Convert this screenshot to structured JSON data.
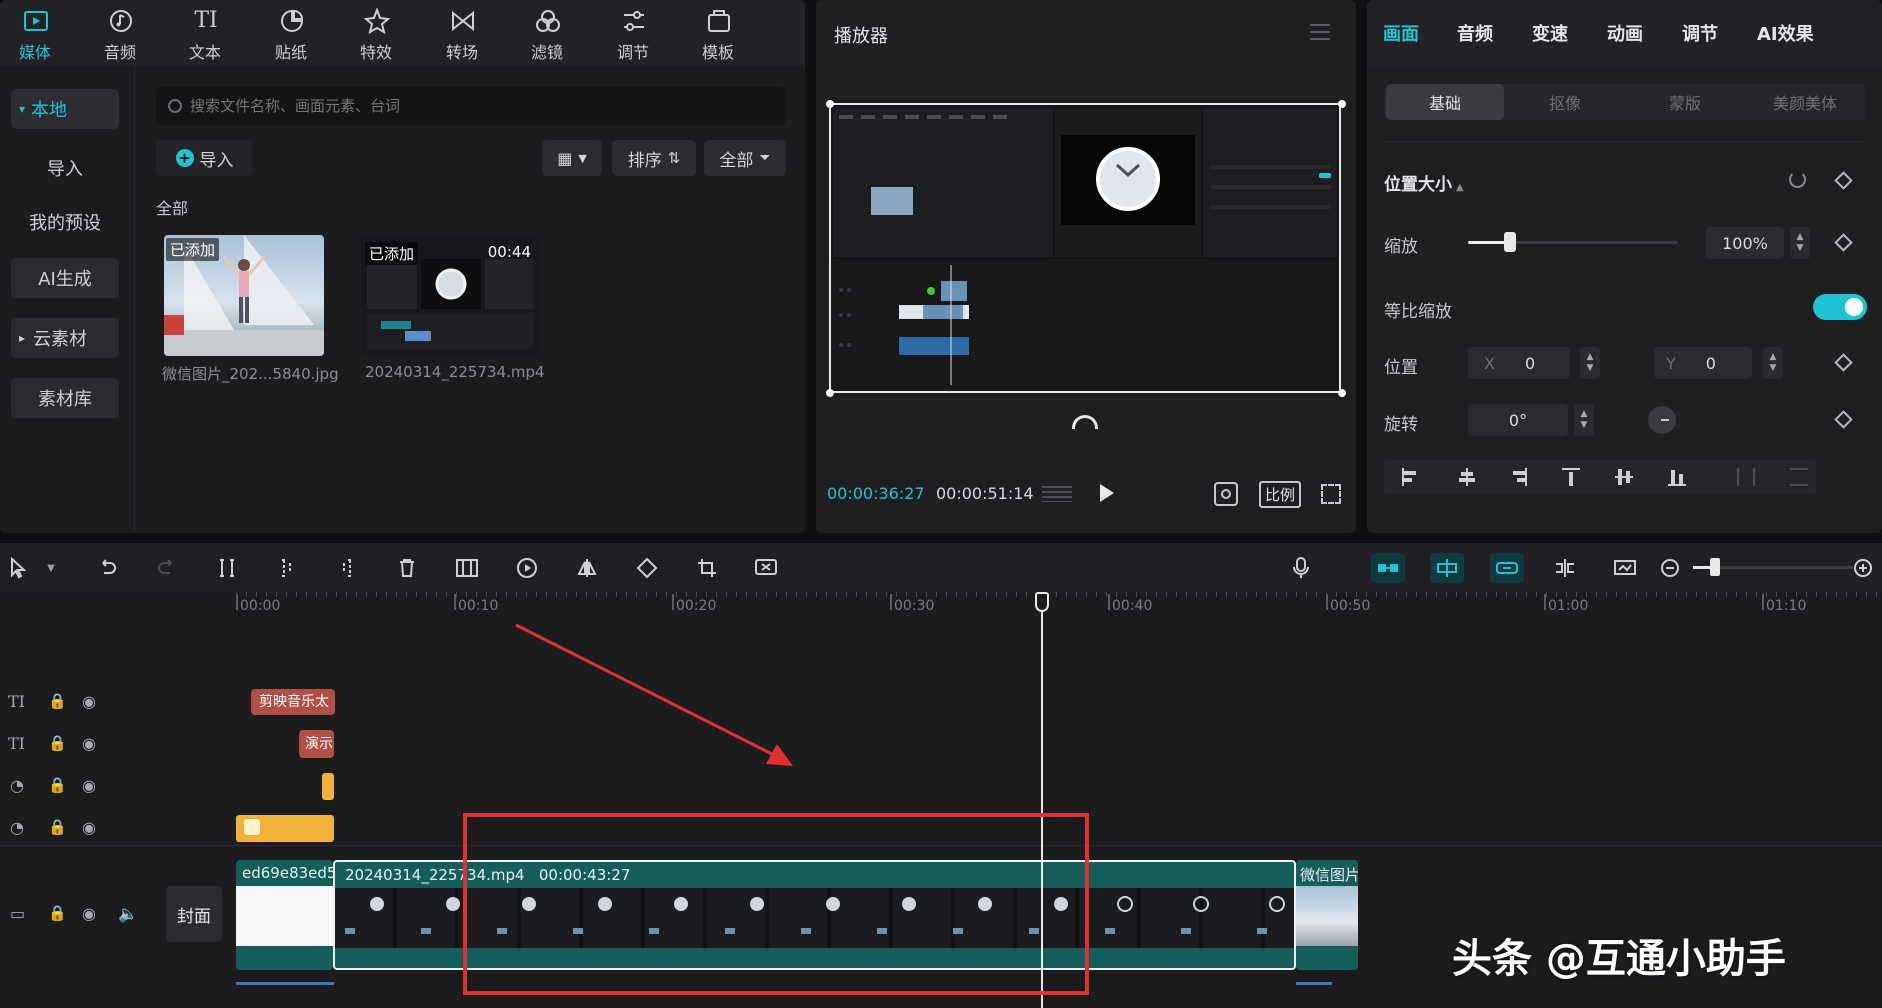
{
  "media_panel": {
    "tabs": [
      {
        "label": "媒体",
        "icon": "media-icon",
        "active": true
      },
      {
        "label": "音频",
        "icon": "audio-icon"
      },
      {
        "label": "文本",
        "icon": "text-icon"
      },
      {
        "label": "贴纸",
        "icon": "sticker-icon"
      },
      {
        "label": "特效",
        "icon": "effects-icon"
      },
      {
        "label": "转场",
        "icon": "transition-icon"
      },
      {
        "label": "滤镜",
        "icon": "filter-icon"
      },
      {
        "label": "调节",
        "icon": "adjust-icon"
      },
      {
        "label": "模板",
        "icon": "template-icon"
      }
    ],
    "sidebar": [
      {
        "label": "本地",
        "active": true,
        "arrow": "▾"
      },
      {
        "label": "导入"
      },
      {
        "label": "我的预设"
      },
      {
        "label": "AI生成"
      },
      {
        "label": "云素材",
        "arrow": "▸"
      },
      {
        "label": "素材库"
      }
    ],
    "search_placeholder": "搜索文件名称、画面元素、台词",
    "import_label": "导入",
    "sort_label": "排序",
    "filter_label": "全部",
    "section_label": "全部",
    "files": [
      {
        "name": "微信图片_202...5840.jpg",
        "badge": "已添加"
      },
      {
        "name": "20240314_225734.mp4",
        "badge": "已添加",
        "duration": "00:44"
      }
    ]
  },
  "player": {
    "title": "播放器",
    "current_time": "00:00:36:27",
    "total_time": "00:00:51:14",
    "ratio_label": "比例"
  },
  "properties": {
    "tabs": [
      "画面",
      "音频",
      "变速",
      "动画",
      "调节",
      "AI效果"
    ],
    "active_tab": "画面",
    "subtabs": [
      "基础",
      "抠像",
      "蒙版",
      "美颜美体"
    ],
    "active_subtab": "基础",
    "section_title": "位置大小",
    "scale_label": "缩放",
    "scale_value": "100%",
    "scale_fraction": 0.2,
    "uniform_label": "等比缩放",
    "uniform_on": true,
    "position_label": "位置",
    "x_label": "X",
    "x_value": "0",
    "y_label": "Y",
    "y_value": "0",
    "rotation_label": "旋转",
    "rotation_value": "0°"
  },
  "timeline": {
    "ruler": [
      "00:00",
      "00:10",
      "00:20",
      "00:30",
      "00:40",
      "00:50",
      "01:00",
      "01:10"
    ],
    "clips": {
      "text1": "剪映音乐太",
      "text2": "演示",
      "main_a": "ed69e83ed5",
      "main_b_name": "20240314_225734.mp4",
      "main_b_duration": "00:00:43:27",
      "main_c": "微信图片"
    },
    "cover_label": "封面"
  },
  "watermark": "头条 @互通小助手",
  "colors": {
    "accent": "#1ec4d2",
    "annotation": "#e03030",
    "clip_teal": "#155e5c"
  }
}
